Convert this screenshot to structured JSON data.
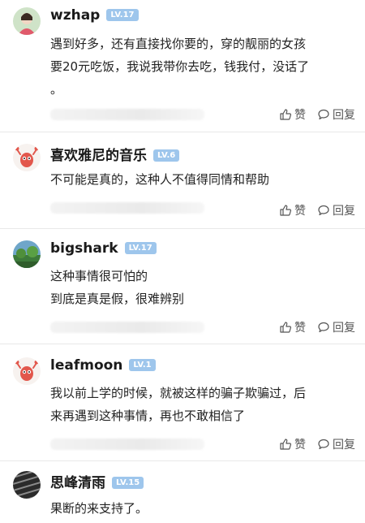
{
  "comments": [
    {
      "username": "wzhap",
      "level": "LV.17",
      "lines": [
        "遇到好多，还有直接找你要的，穿的靓丽的女孩",
        "要20元吃饭，我说我带你去吃，钱我付，没话了",
        "。"
      ],
      "like_label": "赞",
      "reply_label": "回复"
    },
    {
      "username": "喜欢雅尼的音乐",
      "level": "LV.6",
      "lines": [
        "不可能是真的，这种人不值得同情和帮助"
      ],
      "like_label": "赞",
      "reply_label": "回复"
    },
    {
      "username": "bigshark",
      "level": "LV.17",
      "lines": [
        "这种事情很可怕的",
        "到底是真是假，很难辨别"
      ],
      "like_label": "赞",
      "reply_label": "回复"
    },
    {
      "username": "leafmoon",
      "level": "LV.1",
      "lines": [
        "我以前上学的时候，就被这样的骗子欺骗过，后",
        "来再遇到这种事情，再也不敢相信了"
      ],
      "like_label": "赞",
      "reply_label": "回复"
    },
    {
      "username": "思峰清雨",
      "level": "LV.15",
      "lines": [
        "果断的来支持了。"
      ]
    }
  ],
  "colors": {
    "level_badge": "#9ec6ec",
    "divider": "#e8e8e8"
  },
  "icons": {
    "like": "thumbs-up-icon",
    "reply": "speech-bubble-icon"
  }
}
